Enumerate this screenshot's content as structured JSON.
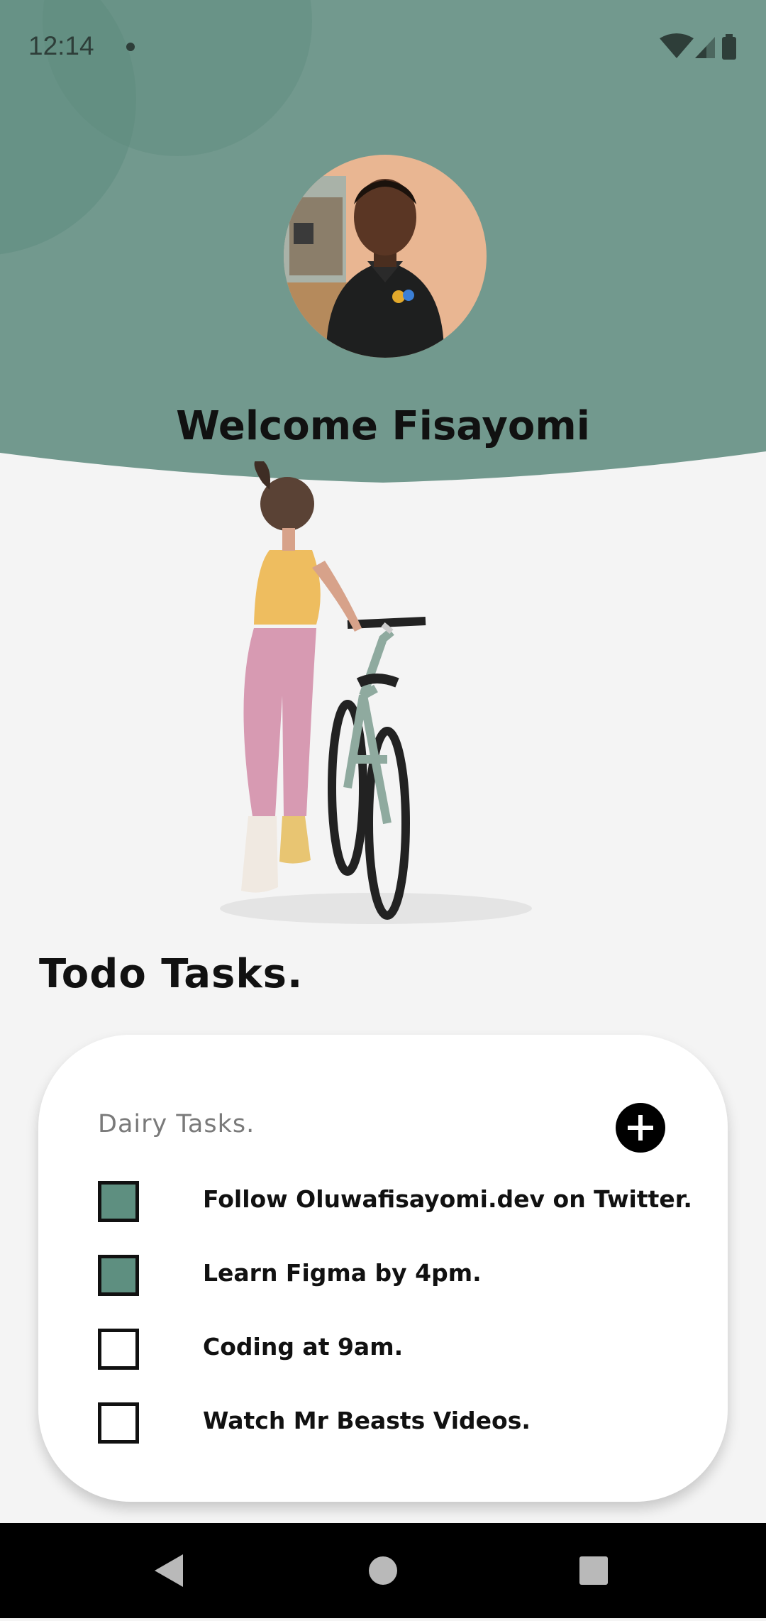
{
  "status_bar": {
    "time": "12:14"
  },
  "header": {
    "welcome": "Welcome Fisayomi",
    "colors": {
      "header_bg": "#72998e",
      "circle": "#5f8c7f"
    }
  },
  "todo": {
    "section_title": "Todo  Tasks.",
    "card_title": "Dairy  Tasks.",
    "add_icon": "plus-icon",
    "tasks": [
      {
        "label": "Follow Oluwafisayomi.dev on Twitter.",
        "checked": true
      },
      {
        "label": "Learn Figma by 4pm.",
        "checked": true
      },
      {
        "label": "Coding at 9am.",
        "checked": false
      },
      {
        "label": "Watch Mr Beasts Videos.",
        "checked": false
      }
    ],
    "colors": {
      "checked": "#5e8f80"
    }
  },
  "nav": {
    "icons": [
      "back-icon",
      "home-icon",
      "recents-icon"
    ]
  }
}
